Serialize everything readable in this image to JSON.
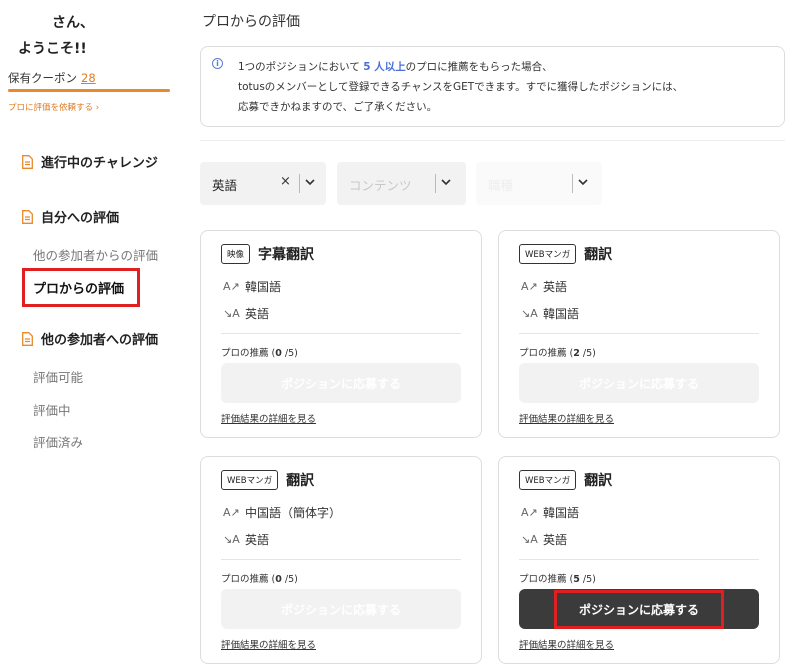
{
  "sidebar": {
    "greeting_line1": "さん、",
    "greeting_line2": "ようこそ!!",
    "coupon_label": "保有クーポン",
    "coupon_count": "28",
    "request_link": "プロに評価を依頼する ›",
    "nav": {
      "challenge": "進行中のチャレンジ",
      "my_eval": "自分への評価",
      "from_others": "他の参加者からの評価",
      "from_pro": "プロからの評価",
      "eval_others": "他の参加者への評価",
      "evaluable": "評価可能",
      "evaluating": "評価中",
      "evaluated": "評価済み"
    }
  },
  "main": {
    "title": "プロからの評価",
    "info": {
      "line1_pre": "1つのポジションにおいて ",
      "line1_hl": "5 人以上",
      "line1_post": "のプロに推薦をもらった場合、",
      "line2": "totusのメンバーとして登録できるチャンスをGETできます。すでに獲得したポジションには、",
      "line3": "応募できかねますので、ご了承ください。"
    },
    "filters": {
      "language": "英語",
      "clear": "×",
      "content_placeholder": "コンテンツ",
      "third_placeholder": "職種"
    },
    "cards": [
      {
        "tag": "映像",
        "title": "字幕翻訳",
        "from": "韓国語",
        "to": "英語",
        "rec_label": "プロの推薦 (",
        "rec_count": "0",
        "rec_total": " /5)",
        "button": "ポジションに応募する",
        "detail": "評価結果の詳細を見る"
      },
      {
        "tag": "WEBマンガ",
        "title": "翻訳",
        "from": "英語",
        "to": "韓国語",
        "rec_label": "プロの推薦 (",
        "rec_count": "2",
        "rec_total": " /5)",
        "button": "ポジションに応募する",
        "detail": "評価結果の詳細を見る"
      },
      {
        "tag": "WEBマンガ",
        "title": "翻訳",
        "from": "中国語（簡体字）",
        "to": "英語",
        "rec_label": "プロの推薦 (",
        "rec_count": "0",
        "rec_total": " /5)",
        "button": "ポジションに応募する",
        "detail": "評価結果の詳細を見る"
      },
      {
        "tag": "WEBマンガ",
        "title": "翻訳",
        "from": "韓国語",
        "to": "英語",
        "rec_label": "プロの推薦 (",
        "rec_count": "5",
        "rec_total": " /5)",
        "button": "ポジションに応募する",
        "detail": "評価結果の詳細を見る"
      }
    ]
  },
  "colors": {
    "accent_orange": "#e8892a",
    "highlight_red": "#e02020",
    "link_blue": "#4a6fd8",
    "button_active": "#3b3b3b"
  }
}
